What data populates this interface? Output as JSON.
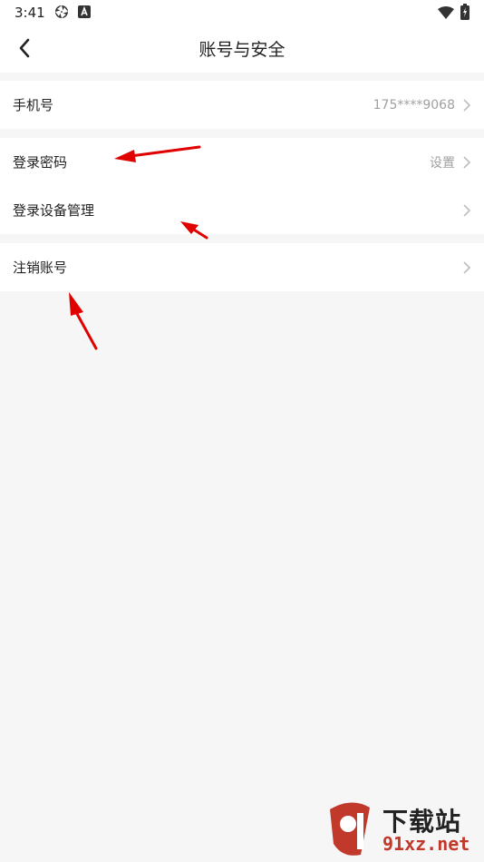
{
  "status": {
    "time": "3:41"
  },
  "header": {
    "title": "账号与安全"
  },
  "groups": [
    {
      "items": [
        {
          "label": "手机号",
          "value": "175****9068"
        }
      ]
    },
    {
      "items": [
        {
          "label": "登录密码",
          "value": "设置"
        },
        {
          "label": "登录设备管理",
          "value": ""
        }
      ]
    },
    {
      "items": [
        {
          "label": "注销账号",
          "value": ""
        }
      ]
    }
  ],
  "watermark": {
    "text1": "下载站",
    "text2": "91xz.net"
  },
  "colors": {
    "annotation_arrow": "#e00000",
    "watermark_red": "#c0392b",
    "value_gray": "#a0a0a0",
    "background": "#f6f6f6"
  }
}
